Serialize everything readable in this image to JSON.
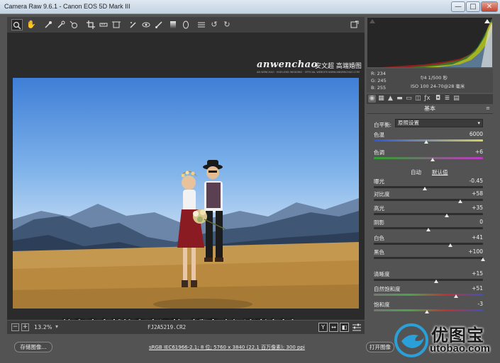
{
  "window": {
    "title": "Camera Raw 9.6.1 -  Canon EOS 5D Mark III",
    "min": "—",
    "max": "□",
    "close": "✕"
  },
  "watermark": {
    "brand": "anwenchao",
    "cn": "安文超 高端婚图",
    "line": "AN WENCHAO · HIGH-END WEDDING · OFFICIAL WEBSITE:WWW.ANWENCHAO.COM"
  },
  "caption": "饱和度自然饱和度调整（我喜欢加清晰去灰）",
  "canvas_bottom": {
    "zoom_minus": "−",
    "zoom_plus": "+",
    "zoom": "13.2%",
    "filename": "FJ2A5219.CR2",
    "view_y": "Y",
    "view_swap": "↔",
    "view_before_after": "◧"
  },
  "readout": {
    "r": "R:  234",
    "g": "G:  245",
    "b": "B:  255",
    "exposure": "f/4   1/500 秒",
    "lens": "ISO 100   24-70@28 毫米"
  },
  "panel": {
    "title": "基本",
    "menu": "≡",
    "wb_label": "白平衡:",
    "wb_value": "原照设置",
    "auto": "自动",
    "default": "默认值",
    "sliders": [
      {
        "label": "色温",
        "value": "6000",
        "fraction": 0.48,
        "track": "temp"
      },
      {
        "label": "色调",
        "value": "+6",
        "fraction": 0.54,
        "track": "tint"
      },
      {
        "label": "曝光",
        "value": "-0.45",
        "fraction": 0.47,
        "track": "plain"
      },
      {
        "label": "对比度",
        "value": "+58",
        "fraction": 0.79,
        "track": "plain"
      },
      {
        "label": "高光",
        "value": "+35",
        "fraction": 0.67,
        "track": "plain"
      },
      {
        "label": "阴影",
        "value": "0",
        "fraction": 0.5,
        "track": "plain"
      },
      {
        "label": "白色",
        "value": "+41",
        "fraction": 0.7,
        "track": "plain"
      },
      {
        "label": "黑色",
        "value": "+100",
        "fraction": 1.0,
        "track": "plain"
      },
      {
        "label": "清晰度",
        "value": "+15",
        "fraction": 0.57,
        "track": "plain"
      },
      {
        "label": "自然饱和度",
        "value": "+51",
        "fraction": 0.75,
        "track": "vib"
      },
      {
        "label": "饱和度",
        "value": "-3",
        "fraction": 0.49,
        "track": "sat"
      }
    ]
  },
  "bottombar": {
    "save": "存储图像...",
    "workflow": "sRGB IEC61966-2.1; 8 位; 5760 x 3840 (22.1 百万像素); 300 ppi",
    "open": "打开图像"
  },
  "site_logo": {
    "name": "优图宝",
    "url": "utobao.com"
  }
}
